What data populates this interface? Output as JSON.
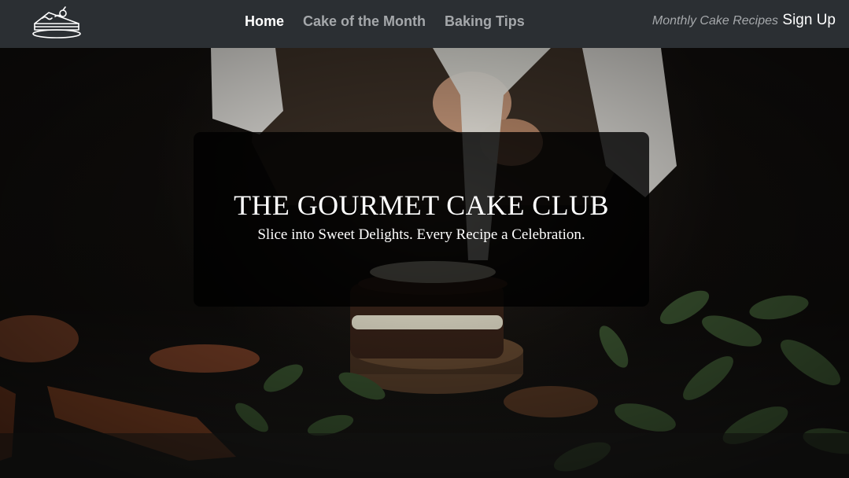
{
  "nav": {
    "links": [
      {
        "label": "Home"
      },
      {
        "label": "Cake of the Month"
      },
      {
        "label": "Baking Tips"
      }
    ],
    "tagline": "Monthly Cake Recipes",
    "signup_label": "Sign Up"
  },
  "hero": {
    "title": "THE GOURMET CAKE CLUB",
    "subtitle": "Slice into Sweet Delights. Every Recipe a Celebration."
  },
  "icons": {
    "logo": "cake-slice-icon"
  },
  "colors": {
    "navbar_bg": "#2b2f33",
    "nav_active": "#ffffff",
    "nav_inactive": "#a5a8ab",
    "overlay": "#000000"
  }
}
